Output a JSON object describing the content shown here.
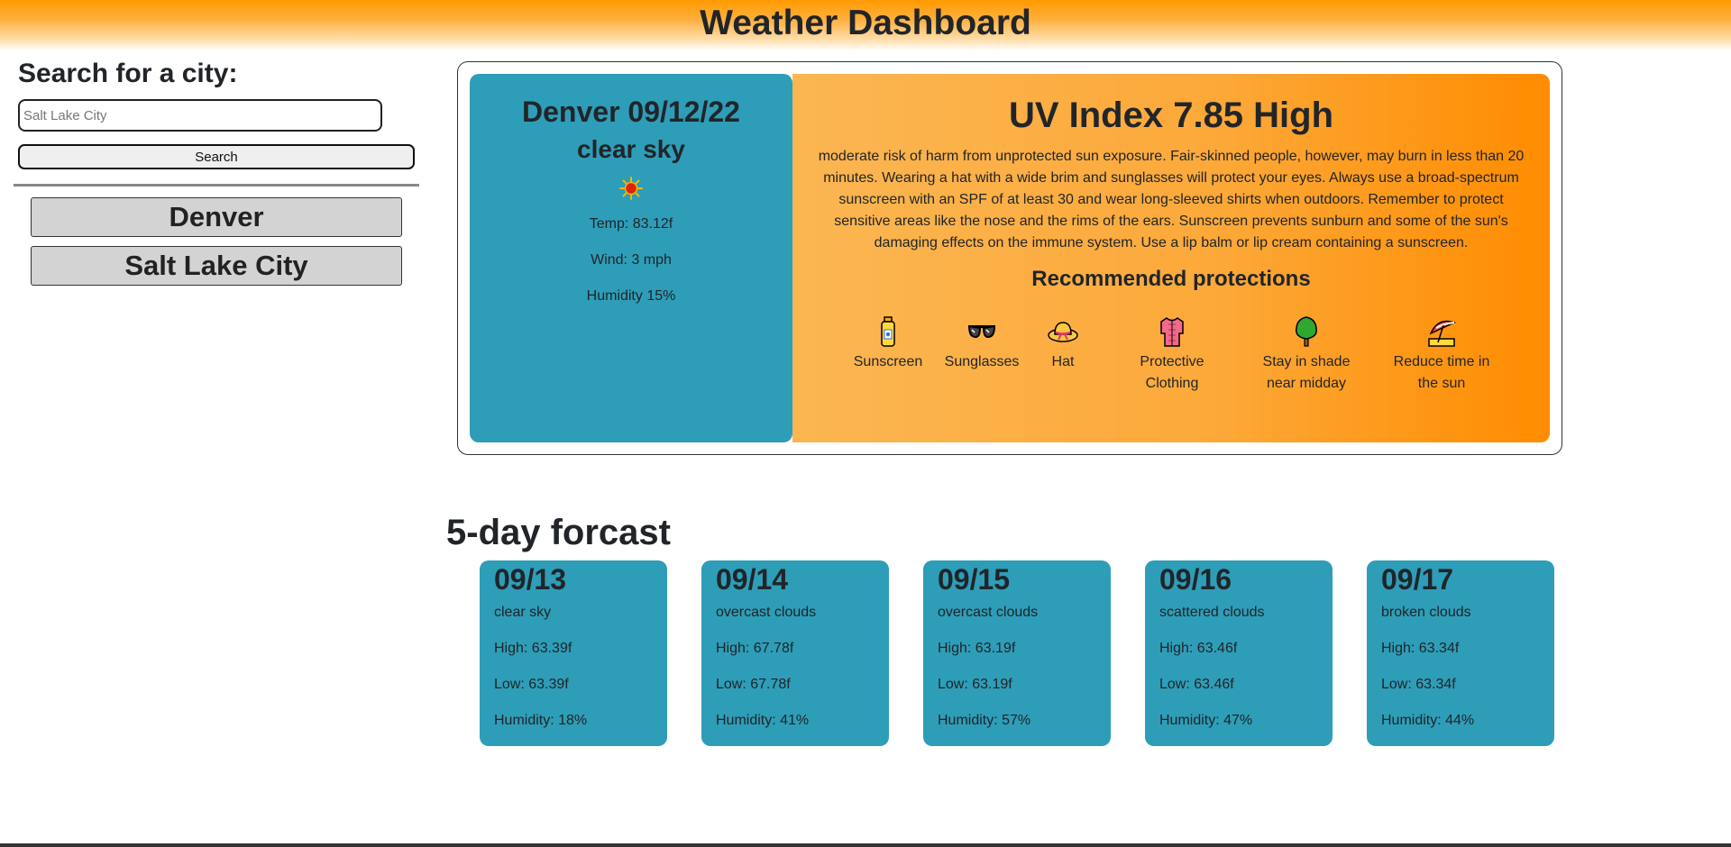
{
  "header": {
    "title": "Weather Dashboard"
  },
  "search": {
    "label": "Search for a city:",
    "input_value": "",
    "placeholder": "Salt Lake City",
    "button_label": "Search"
  },
  "history": [
    {
      "label": "Denver"
    },
    {
      "label": "Salt Lake City"
    }
  ],
  "current": {
    "city_date": "Denver 09/12/22",
    "description": "clear sky",
    "icon": "sun-icon",
    "temp": "Temp: 83.12f",
    "wind": "Wind: 3 mph",
    "humidity": "Humidity 15%"
  },
  "uv": {
    "title": "UV Index 7.85 High",
    "text": "moderate risk of harm from unprotected sun exposure. Fair-skinned people, however, may burn in less than 20 minutes. Wearing a hat with a wide brim and sunglasses will protect your eyes. Always use a broad-spectrum sunscreen with an SPF of at least 30 and wear long-sleeved shirts when outdoors. Remember to protect sensitive areas like the nose and the rims of the ears. Sunscreen prevents sunburn and some of the sun's damaging effects on the immune system. Use a lip balm or lip cream containing a sunscreen.",
    "recommended_title": "Recommended protections",
    "protections": [
      {
        "label": "Sunscreen",
        "icon": "sunscreen-icon"
      },
      {
        "label": "Sunglasses",
        "icon": "sunglasses-icon"
      },
      {
        "label": "Hat",
        "icon": "hat-icon"
      },
      {
        "label": "Protective Clothing",
        "icon": "shirt-icon"
      },
      {
        "label": "Stay in shade near midday",
        "icon": "tree-icon"
      },
      {
        "label": "Reduce time in the sun",
        "icon": "umbrella-icon"
      }
    ]
  },
  "forecast": {
    "title": "5-day forcast",
    "days": [
      {
        "date": "09/13",
        "desc": "clear sky",
        "high": "High: 63.39f",
        "low": "Low: 63.39f",
        "humidity": "Humidity: 18%"
      },
      {
        "date": "09/14",
        "desc": "overcast clouds",
        "high": "High: 67.78f",
        "low": "Low: 67.78f",
        "humidity": "Humidity: 41%"
      },
      {
        "date": "09/15",
        "desc": "overcast clouds",
        "high": "High: 63.19f",
        "low": "Low: 63.19f",
        "humidity": "Humidity: 57%"
      },
      {
        "date": "09/16",
        "desc": "scattered clouds",
        "high": "High: 63.46f",
        "low": "Low: 63.46f",
        "humidity": "Humidity: 47%"
      },
      {
        "date": "09/17",
        "desc": "broken clouds",
        "high": "High: 63.34f",
        "low": "Low: 63.34f",
        "humidity": "Humidity: 44%"
      }
    ]
  },
  "colors": {
    "card_teal": "#2e9db8",
    "uv_orange": "#ff8c00",
    "header_orange": "#ff9a00"
  }
}
